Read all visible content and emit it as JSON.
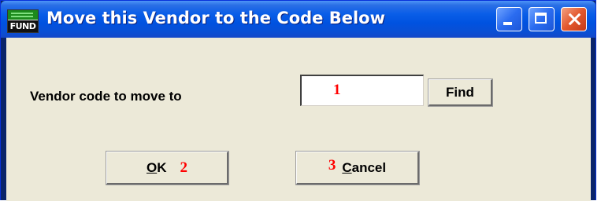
{
  "window": {
    "title": "Move this Vendor to the Code Below",
    "icon_text": "FUND",
    "controls": [
      "minimize-icon",
      "maximize-icon",
      "close-icon"
    ]
  },
  "form": {
    "vendor_label": "Vendor code to move to",
    "vendor_code_value": "",
    "marker_1": "1"
  },
  "buttons": {
    "find": {
      "label": "Find"
    },
    "ok": {
      "mnemonic": "O",
      "rest": "K",
      "marker": "2"
    },
    "cancel": {
      "marker": "3",
      "mnemonic": "C",
      "rest": "ancel"
    }
  },
  "colors": {
    "titlebar": "#0052e0",
    "client_bg": "#ece9d8",
    "marker": "#ff0000",
    "close_button": "#e3582d"
  }
}
